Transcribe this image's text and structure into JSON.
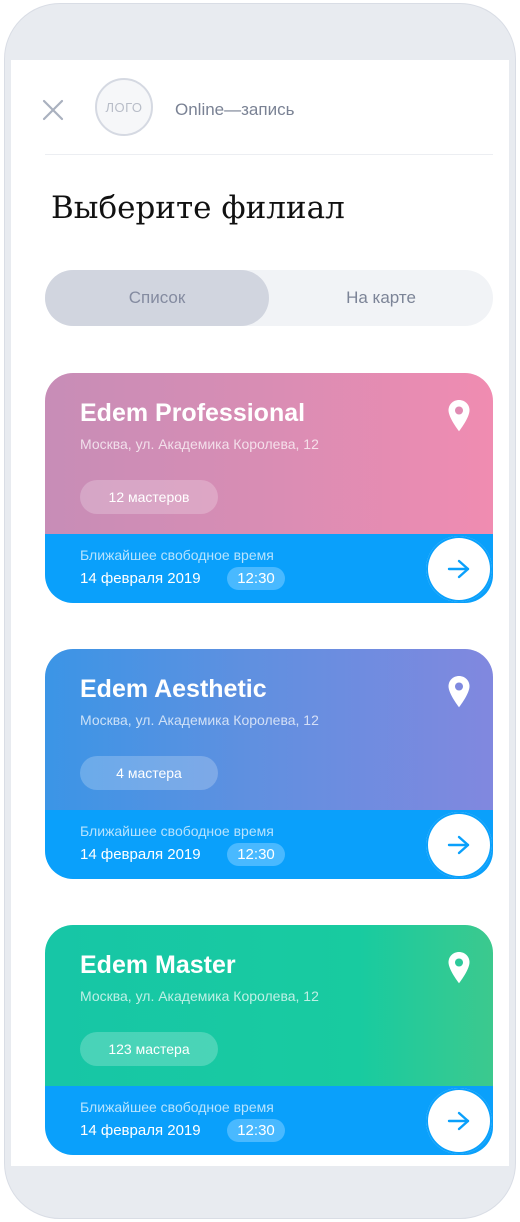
{
  "header": {
    "logo_text": "ЛОГО",
    "title": "Online—запись"
  },
  "page_title": "Выберите филиал",
  "tabs": [
    {
      "label": "Список",
      "active": true
    },
    {
      "label": "На карте",
      "active": false
    }
  ],
  "branches": [
    {
      "name": "Edem Professional",
      "address": "Москва, ул. Академика Королева, 12",
      "masters": "12 мастеров",
      "next_label": "Ближайшее свободное время",
      "next_date": "14 февраля 2019",
      "next_time": "12:30"
    },
    {
      "name": "Edem Aesthetic",
      "address": "Москва, ул. Академика Королева, 12",
      "masters": "4 мастера",
      "next_label": "Ближайшее свободное время",
      "next_date": "14 февраля 2019",
      "next_time": "12:30"
    },
    {
      "name": "Edem Master",
      "address": "Москва, ул. Академика Королева, 12",
      "masters": "123 мастера",
      "next_label": "Ближайшее свободное время",
      "next_date": "14 февраля 2019",
      "next_time": "12:30"
    }
  ],
  "icons": {
    "close": "close-icon",
    "pin": "map-pin-icon",
    "arrow": "arrow-right-icon"
  },
  "colors": {
    "accent": "#0aa0fb",
    "card_1": "#e08cb3",
    "card_2": "#6a8fe2",
    "card_3": "#17c8a3"
  }
}
